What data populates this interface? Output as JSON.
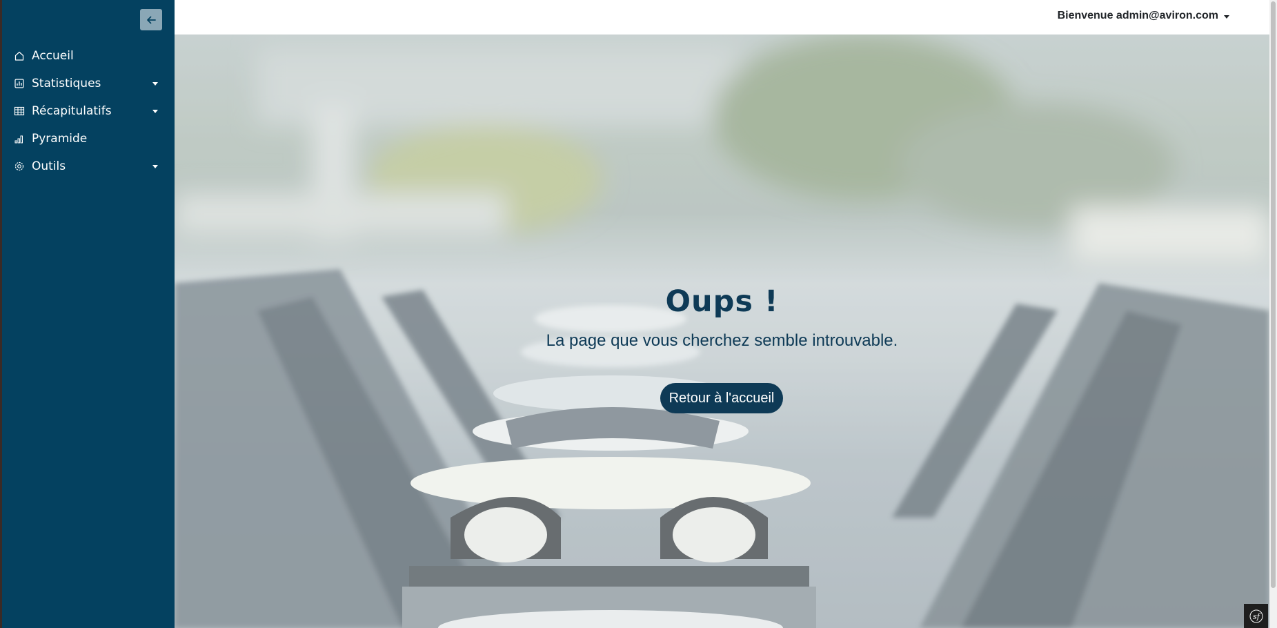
{
  "sidebar": {
    "items": [
      {
        "label": "Accueil",
        "icon": "home-icon",
        "has_submenu": false
      },
      {
        "label": "Statistiques",
        "icon": "bar-chart-icon",
        "has_submenu": true
      },
      {
        "label": "Récapitulatifs",
        "icon": "table-icon",
        "has_submenu": true
      },
      {
        "label": "Pyramide",
        "icon": "signal-icon",
        "has_submenu": false
      },
      {
        "label": "Outils",
        "icon": "gear-icon",
        "has_submenu": true
      }
    ]
  },
  "header": {
    "user_menu_label": "Bienvenue admin@aviron.com"
  },
  "main": {
    "error_title": "Oups !",
    "error_message": "La page que vous cherchez semble introuvable.",
    "back_button_label": "Retour à l'accueil"
  },
  "colors": {
    "sidebar_bg": "#044160",
    "accent": "#0e3a56",
    "collapse_btn": "#8aa7b6"
  }
}
